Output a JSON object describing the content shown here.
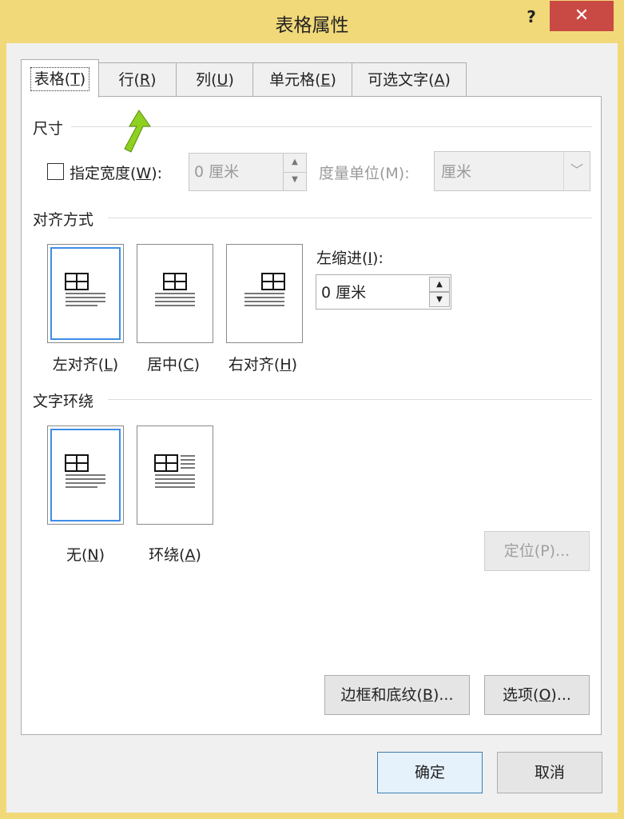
{
  "window": {
    "title": "表格属性",
    "help_label": "?",
    "close_label": "✕",
    "frame_color": "#f1d97a",
    "close_color": "#c94a44"
  },
  "tabs": [
    {
      "label": "表格(",
      "key": "T",
      "tail": ")",
      "active": true
    },
    {
      "label": "行(",
      "key": "R",
      "tail": ")",
      "active": false
    },
    {
      "label": "列(",
      "key": "U",
      "tail": ")",
      "active": false
    },
    {
      "label": "单元格(",
      "key": "E",
      "tail": ")",
      "active": false
    },
    {
      "label": "可选文字(",
      "key": "A",
      "tail": ")",
      "active": false
    }
  ],
  "size": {
    "group_label": "尺寸",
    "width_check_label": "指定宽度(",
    "width_check_key": "W",
    "width_check_tail": "):",
    "width_checked": false,
    "width_value": "0 厘米",
    "unit_label": "度量单位(M):",
    "unit_value": "厘米"
  },
  "alignment": {
    "group_label": "对齐方式",
    "options": [
      {
        "label": "左对齐(",
        "key": "L",
        "tail": ")",
        "selected": true
      },
      {
        "label": "居中(",
        "key": "C",
        "tail": ")",
        "selected": false
      },
      {
        "label": "右对齐(",
        "key": "H",
        "tail": ")",
        "selected": false
      }
    ],
    "indent_label": "左缩进(",
    "indent_key": "I",
    "indent_tail": "):",
    "indent_value": "0 厘米"
  },
  "wrapping": {
    "group_label": "文字环绕",
    "options": [
      {
        "label": "无(",
        "key": "N",
        "tail": ")",
        "selected": true
      },
      {
        "label": "环绕(",
        "key": "A",
        "tail": ")",
        "selected": false
      }
    ],
    "position_button": "定位(P)..."
  },
  "buttons": {
    "borders_label": "边框和底纹(",
    "borders_key": "B",
    "borders_tail": ")...",
    "options_label": "选项(",
    "options_key": "O",
    "options_tail": ")...",
    "ok": "确定",
    "cancel": "取消"
  },
  "annotation": {
    "arrow_color": "#8ed11e",
    "icon": "green-up-arrow-icon"
  },
  "accent_color": "#3d8ee6"
}
